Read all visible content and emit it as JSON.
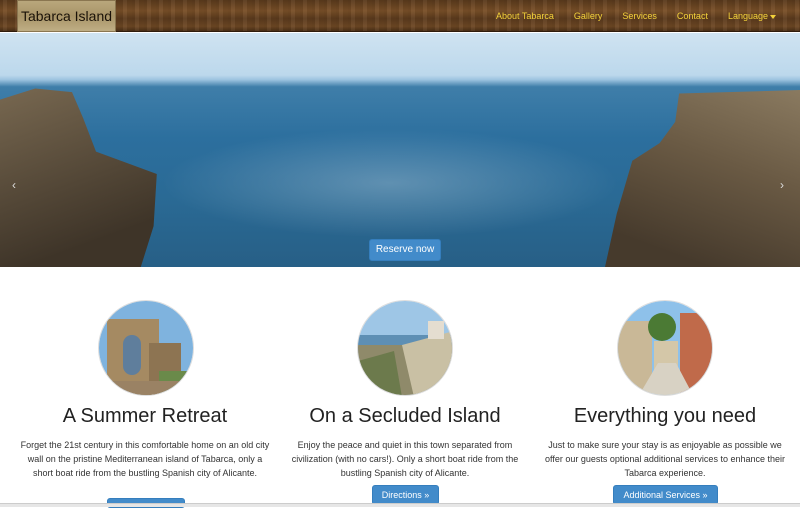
{
  "navbar": {
    "brand": "Tabarca Island",
    "links": [
      "About Tabarca",
      "Gallery",
      "Services",
      "Contact",
      "Language"
    ]
  },
  "hero": {
    "reserve_label": "Reserve now",
    "prev_arrow": "‹",
    "next_arrow": "›",
    "slide_count": 6,
    "active_slide": 3
  },
  "features": [
    {
      "image": "stone-arch-ruins",
      "heading": "A Summer Retreat",
      "text": "Forget the 21st century in this comfortable home on an old city wall on the pristine Mediterranean island of Tabarca, only a short boat ride from the bustling Spanish city of Alicante.",
      "button": ""
    },
    {
      "image": "town-wall-view",
      "heading": "On a Secluded Island",
      "text": "Enjoy the peace and quiet in this town separated from civilization (with no cars!). Only a short boat ride from the bustling Spanish city of Alicante.",
      "button": "Directions »"
    },
    {
      "image": "village-street",
      "heading": "Everything you need",
      "text": "Just to make sure your stay is as enjoyable as possible we offer our guests optional additional services to enhance their Tabarca experience.",
      "button": "Additional Services »"
    }
  ],
  "colors": {
    "accent": "#428bca",
    "nav_link": "#f3d23a"
  }
}
